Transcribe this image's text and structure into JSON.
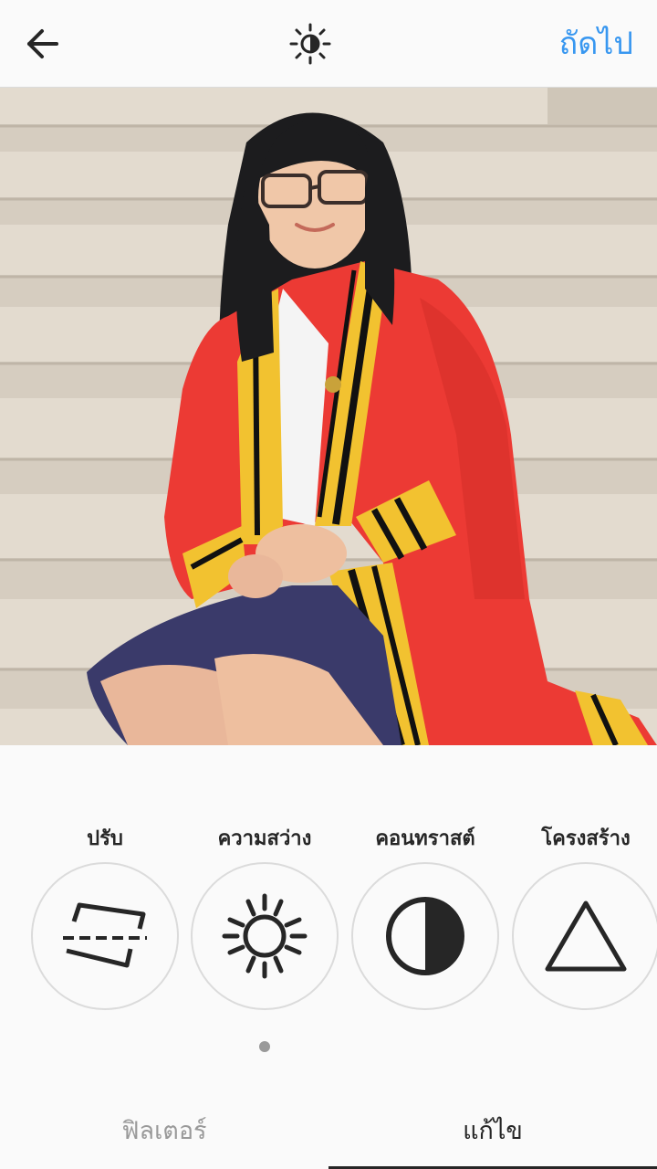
{
  "header": {
    "back_icon": "arrow-left-icon",
    "lux_icon": "lux-sun-half-icon",
    "next_label": "ถัดไป"
  },
  "photo": {
    "description_icon": "photo-preview"
  },
  "tools": [
    {
      "label": "ปรับ",
      "icon": "adjust-straighten-icon"
    },
    {
      "label": "ความสว่าง",
      "icon": "brightness-sun-icon"
    },
    {
      "label": "คอนทราสต์",
      "icon": "contrast-half-circle-icon"
    },
    {
      "label": "โครงสร้าง",
      "icon": "structure-triangle-icon"
    }
  ],
  "tabs": {
    "filter_label": "ฟิลเตอร์",
    "edit_label": "แก้ไข",
    "active": "edit"
  },
  "colors": {
    "accent": "#3897f0",
    "text": "#262626",
    "inactive": "#999999"
  }
}
